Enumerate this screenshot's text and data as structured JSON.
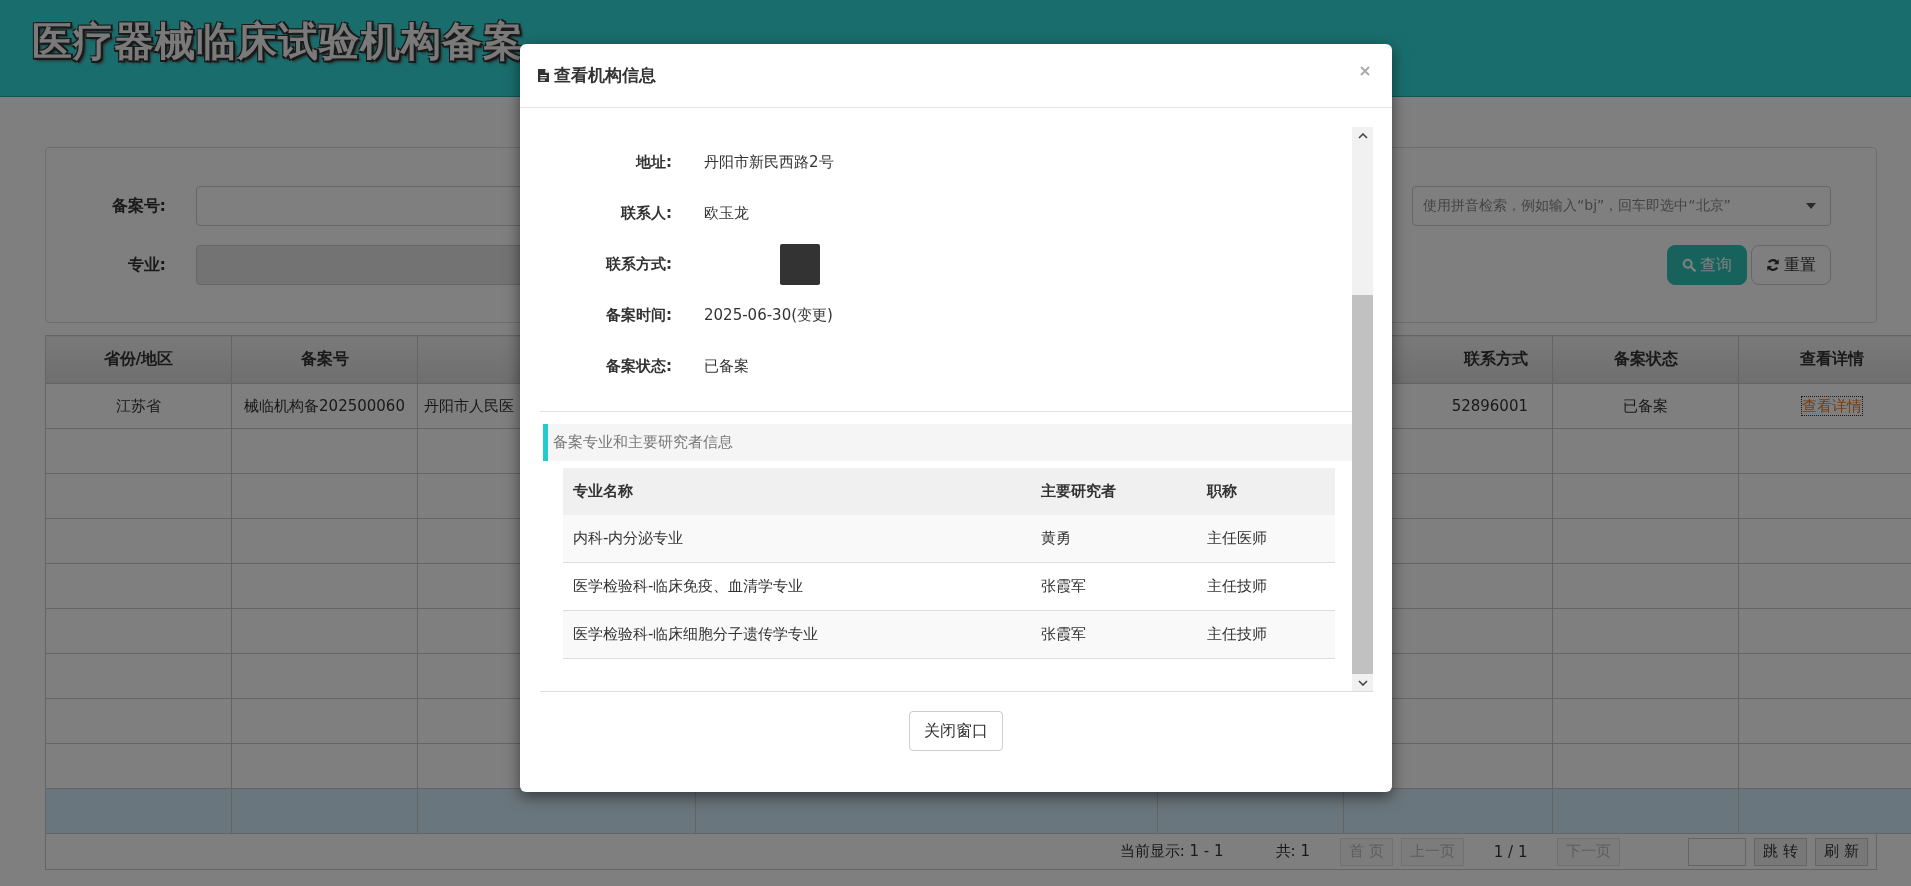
{
  "header": {
    "title": "医疗器械临床试验机构备案"
  },
  "filters": {
    "fields": [
      {
        "label": "备案号:",
        "kind": "text"
      },
      {
        "label": "专业:",
        "kind": "select"
      }
    ],
    "region_select": {
      "placeholder": "使用拼音检索，例如输入“bj”，回车即选中“北京”"
    },
    "buttons": [
      {
        "label": "查询",
        "kind": "primary"
      },
      {
        "label": "重置",
        "kind": "default"
      }
    ]
  },
  "table": {
    "columns": [
      {
        "label": "省份/地区"
      },
      {
        "label": "备案号"
      },
      {},
      {},
      {},
      {
        "label": "联系方式"
      },
      {
        "label": "备案状态"
      },
      {
        "label": "查看详情"
      }
    ],
    "rows": [
      {
        "selected": false,
        "cells": [
          {
            "text": "江苏省"
          },
          {
            "text": "械临机构备202500060"
          },
          {
            "text": "丹阳市人民医"
          },
          {},
          {},
          {
            "text": "52896001"
          },
          {
            "text": "已备案"
          },
          {
            "text": "查看详情",
            "kind": "link"
          }
        ]
      },
      {
        "selected": false
      },
      {
        "selected": false
      },
      {
        "selected": false
      },
      {
        "selected": false
      },
      {
        "selected": false
      },
      {
        "selected": false
      },
      {
        "selected": false
      },
      {
        "selected": false
      },
      {
        "selected": true
      }
    ]
  },
  "pager": [
    {
      "kind": "text",
      "text": "当前显示: 1 - 1"
    },
    {
      "kind": "text",
      "text": "共: 1"
    },
    {
      "kind": "button",
      "label": "首 页",
      "disabled": true
    },
    {
      "kind": "button",
      "label": "上一页",
      "disabled": true
    },
    {
      "kind": "text",
      "text": "1 / 1"
    },
    {
      "kind": "button",
      "label": "下一页",
      "disabled": true
    },
    {
      "kind": "input"
    },
    {
      "kind": "button",
      "label": "跳 转",
      "disabled": false
    },
    {
      "kind": "button",
      "label": "刷 新",
      "disabled": false
    }
  ],
  "modal": {
    "title": "查看机构信息",
    "fields": [
      {
        "label": "地址:",
        "kind": "text",
        "value": "丹阳市新民西路2号"
      },
      {
        "label": "联系人:",
        "kind": "text",
        "value": "欧玉龙"
      },
      {
        "label": "联系方式:",
        "kind": "redacted"
      },
      {
        "label": "备案时间:",
        "kind": "text",
        "value": "2025-06-30(变更)"
      },
      {
        "label": "备案状态:",
        "kind": "text",
        "value": "已备案"
      }
    ],
    "section_title": "备案专业和主要研究者信息",
    "table": {
      "columns": [
        "专业名称",
        "主要研究者",
        "职称"
      ],
      "rows": [
        [
          "内科-内分泌专业",
          "黄勇",
          "主任医师"
        ],
        [
          "医学检验科-临床免疫、血清学专业",
          "张霞军",
          "主任技师"
        ],
        [
          "医学检验科-临床细胞分子遗传学专业",
          "张霞军",
          "主任技师"
        ]
      ]
    },
    "close_button": "关闭窗口"
  }
}
